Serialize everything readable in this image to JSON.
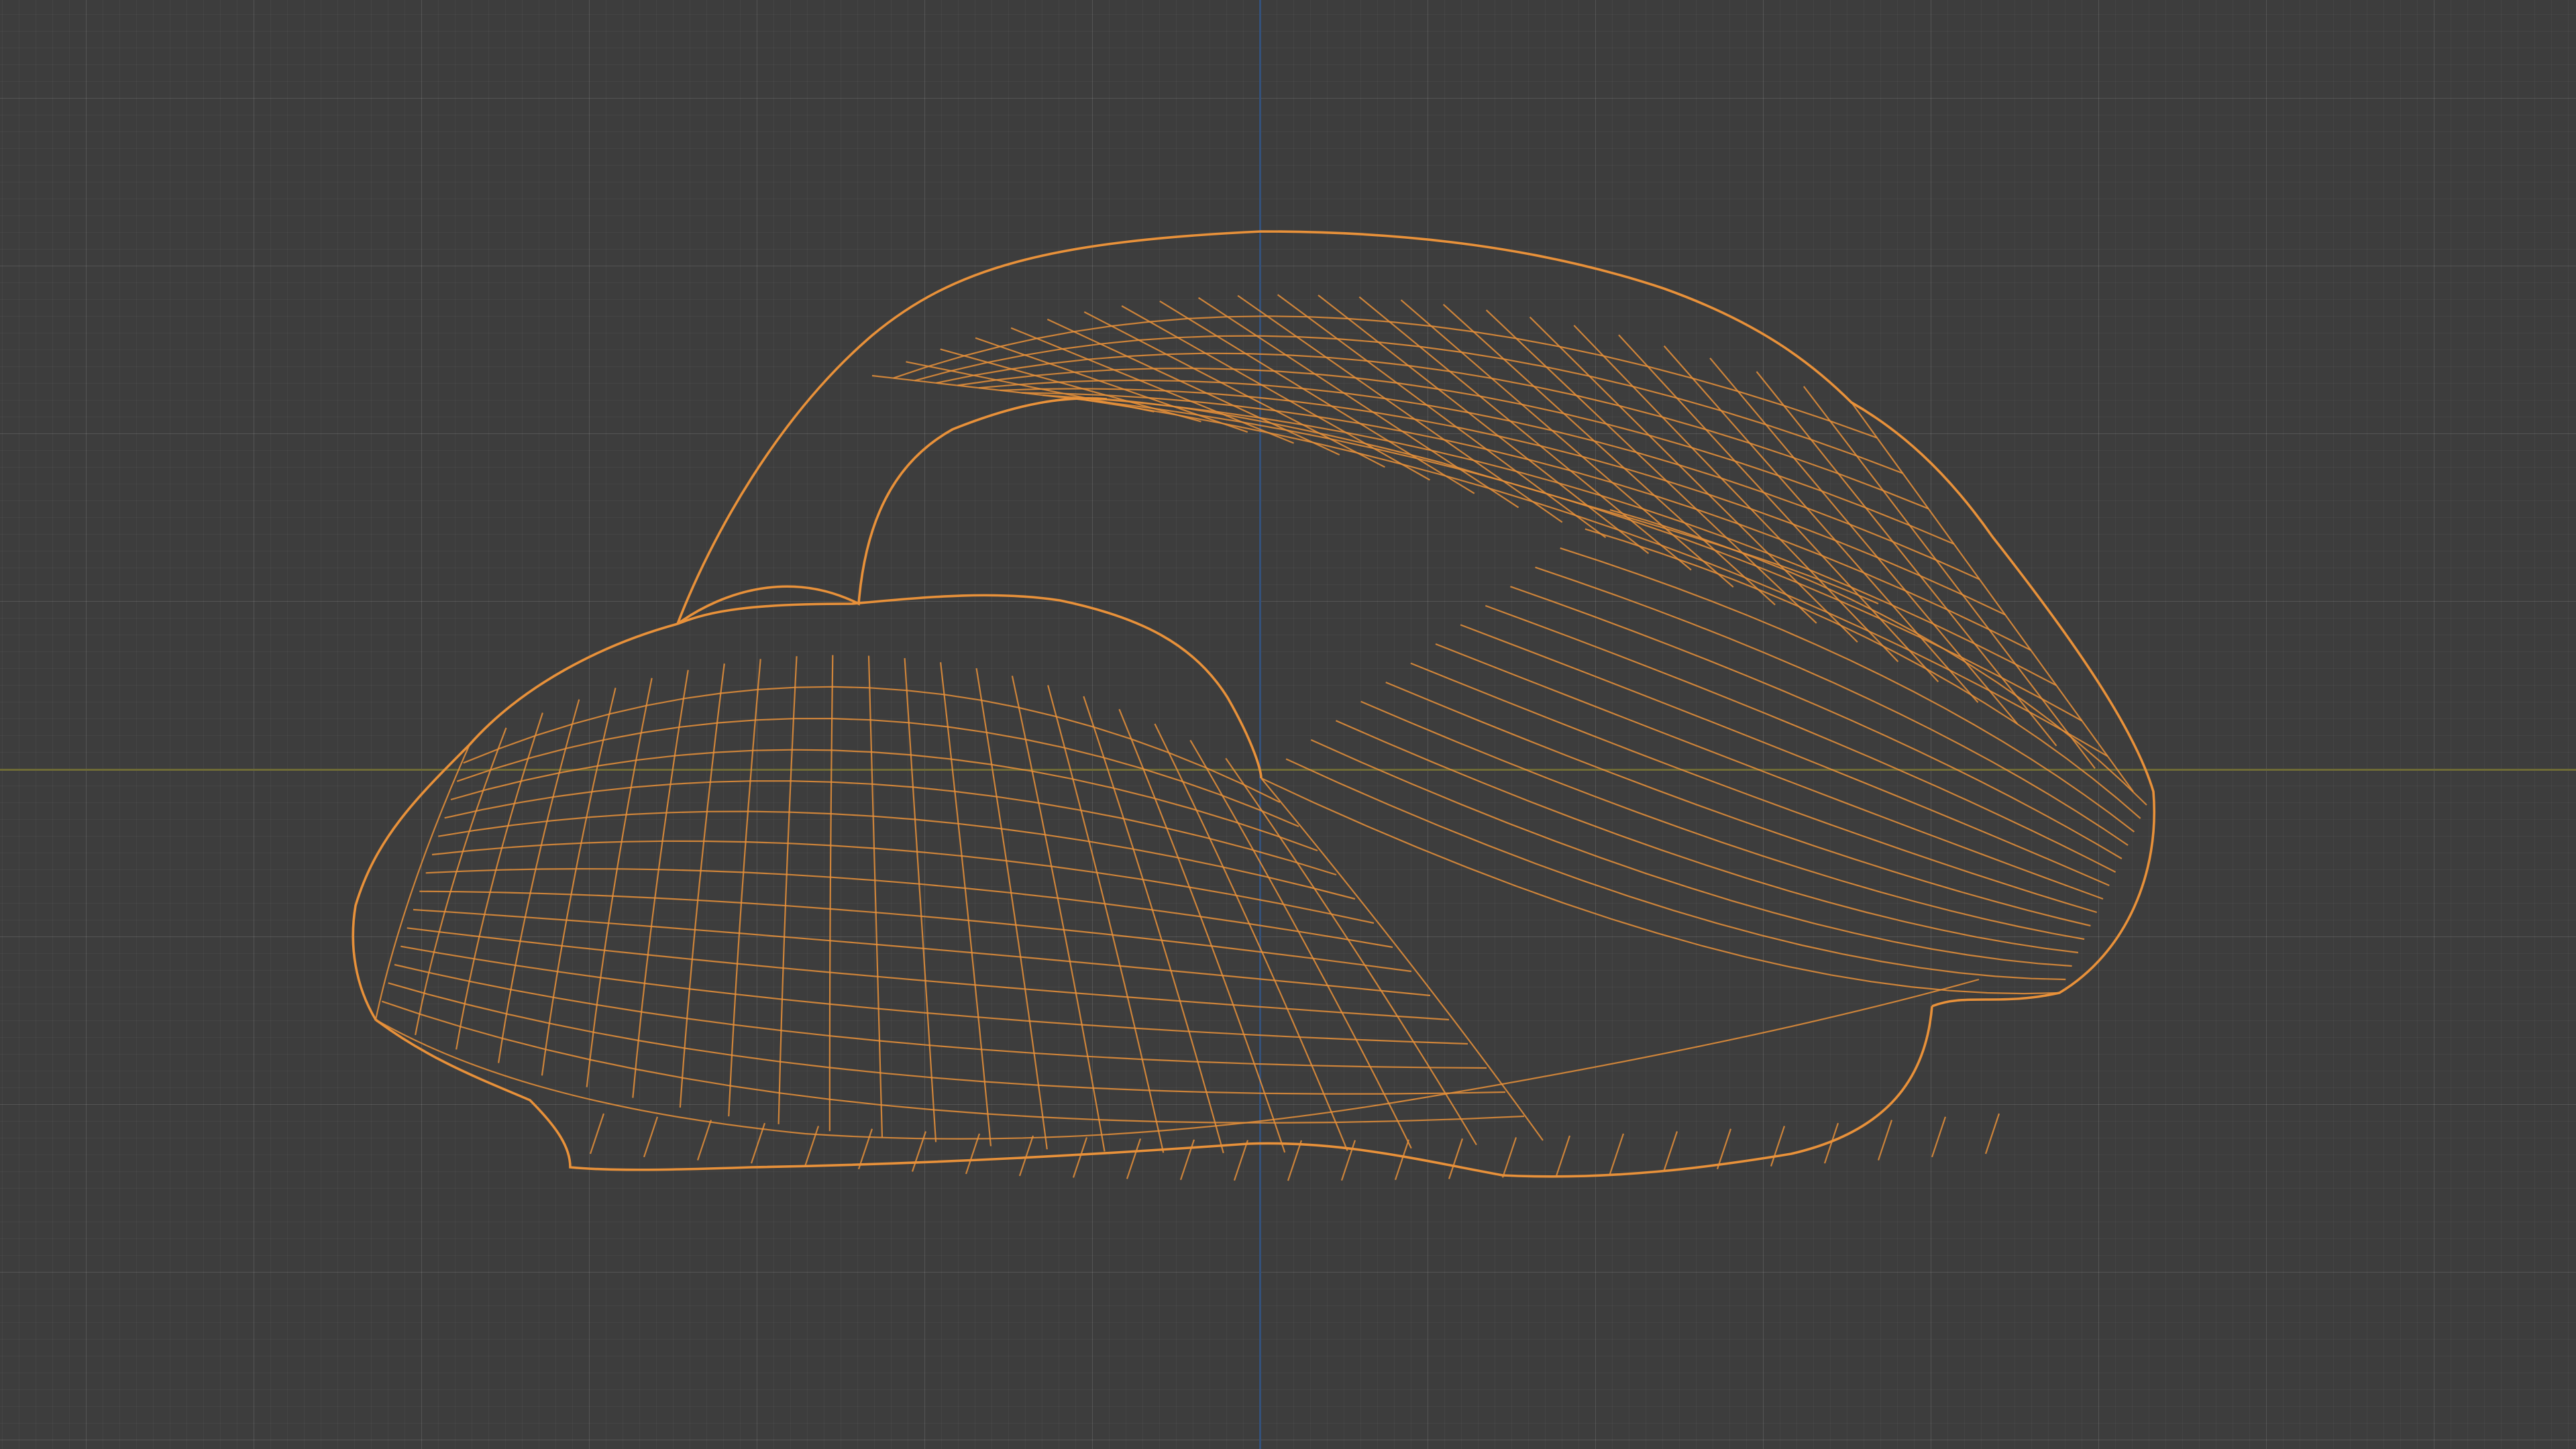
{
  "viewport": {
    "background": "#3d3d3d",
    "grid_major_color": "#4a4a4a",
    "grid_minor_color": "#434343",
    "x_axis_color": "#6e6b36",
    "z_axis_color": "#34517a"
  },
  "object": {
    "selection_color": "#e8913a",
    "display": "wireframe",
    "selected": true
  }
}
